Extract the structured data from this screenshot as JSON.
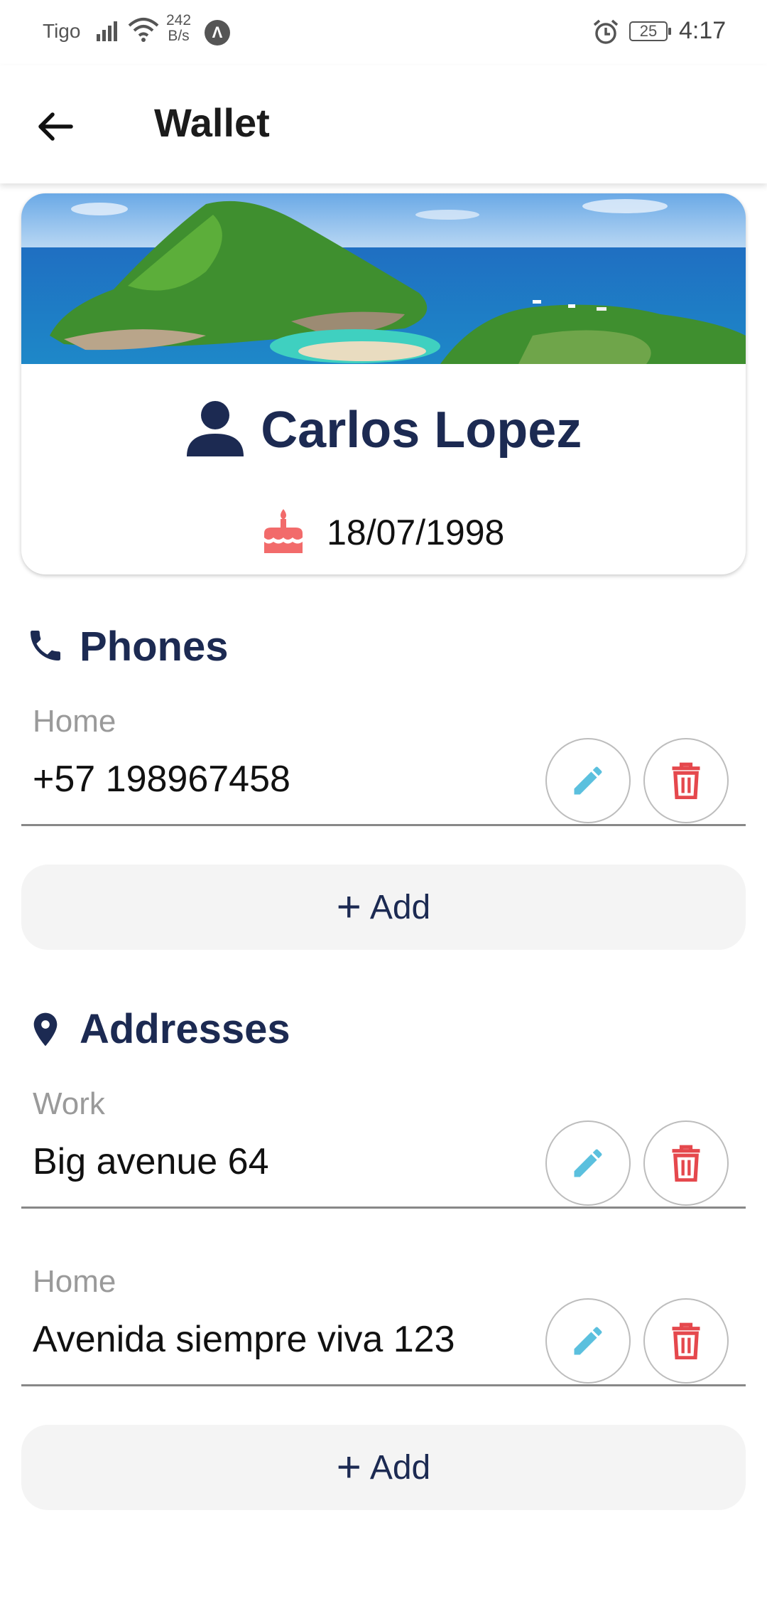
{
  "status_bar": {
    "carrier": "Tigo",
    "speed_value": "242",
    "speed_unit": "B/s",
    "app_badge": "Λ",
    "battery": "25",
    "time": "4:17"
  },
  "app_bar": {
    "title": "Wallet"
  },
  "profile": {
    "name": "Carlos Lopez",
    "birthdate": "18/07/1998"
  },
  "phones": {
    "title": "Phones",
    "items": [
      {
        "label": "Home",
        "value": "+57 198967458"
      }
    ],
    "add_label": "Add"
  },
  "addresses": {
    "title": "Addresses",
    "items": [
      {
        "label": "Work",
        "value": "Big avenue 64"
      },
      {
        "label": "Home",
        "value": "Avenida siempre viva 123"
      }
    ],
    "add_label": "Add"
  },
  "colors": {
    "primary": "#1c2a52",
    "edit": "#5bc0de",
    "delete": "#e5484d",
    "cake": "#f26b6b"
  }
}
